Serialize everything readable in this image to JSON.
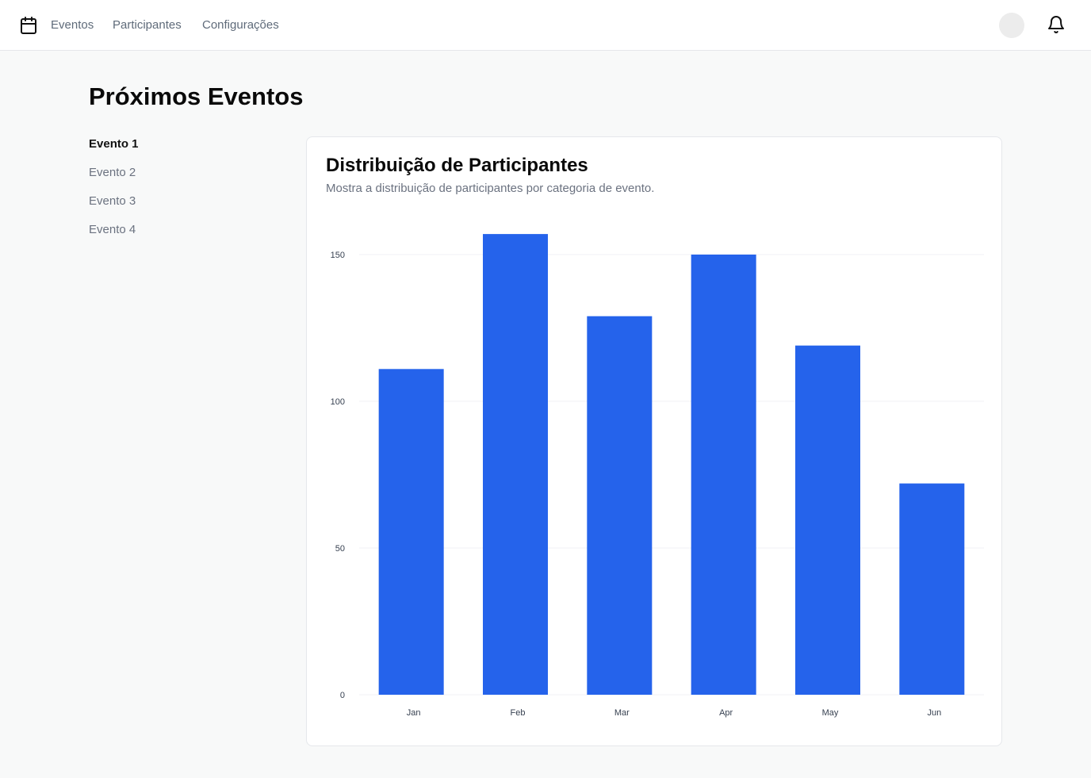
{
  "header": {
    "nav": [
      "Eventos",
      "Participantes",
      "Configurações"
    ],
    "icons": {
      "logo": "calendar-icon",
      "notifications": "bell-icon",
      "avatar": "avatar"
    }
  },
  "page": {
    "title": "Próximos Eventos"
  },
  "sidebar": {
    "items": [
      {
        "label": "Evento 1",
        "active": true
      },
      {
        "label": "Evento 2",
        "active": false
      },
      {
        "label": "Evento 3",
        "active": false
      },
      {
        "label": "Evento 4",
        "active": false
      }
    ]
  },
  "card": {
    "title": "Distribuição de Participantes",
    "description": "Mostra a distribuição de participantes por categoria de evento."
  },
  "colors": {
    "bar": "#2563eb",
    "grid": "#f1f2f4",
    "background": "#f8f9f9"
  },
  "chart_data": {
    "type": "bar",
    "categories": [
      "Jan",
      "Feb",
      "Mar",
      "Apr",
      "May",
      "Jun"
    ],
    "values": [
      111,
      157,
      129,
      150,
      119,
      72
    ],
    "yticks": [
      0,
      50,
      100,
      150
    ],
    "ylim": [
      0,
      150
    ],
    "grid": true,
    "legend": "none",
    "title": "",
    "xlabel": "",
    "ylabel": ""
  }
}
